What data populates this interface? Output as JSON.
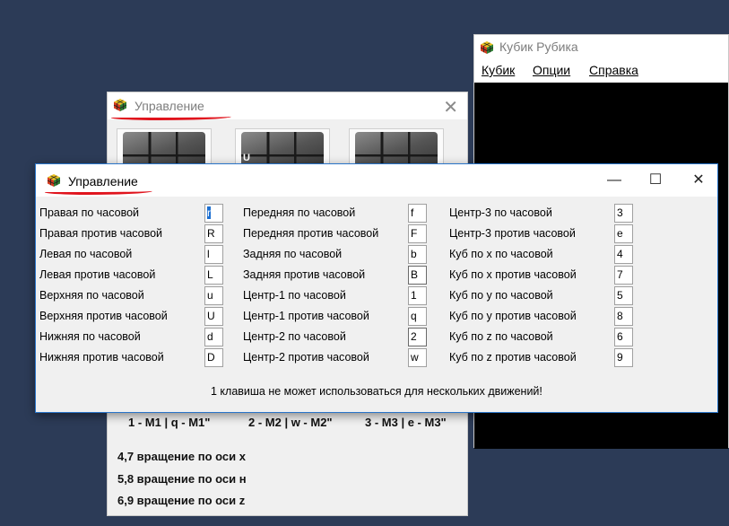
{
  "cube_window": {
    "title": "Кубик Рубика",
    "menu": [
      "Кубик",
      "Опции",
      "Справка"
    ]
  },
  "back_window": {
    "title": "Управление",
    "move_buttons": [
      {
        "letter": ""
      },
      {
        "letter": "U"
      },
      {
        "letter": ""
      }
    ],
    "hint_line": [
      "1 - M1 | q - M1\"",
      "2 - M2 | w - M2\"",
      "3 - M3 | e - M3\""
    ],
    "axis_lines": [
      "4,7 вращение по оси x",
      "5,8 вращение по оси н",
      "6,9 вращение по оси z"
    ]
  },
  "front_window": {
    "title": "Управление",
    "columns": [
      {
        "rows": [
          {
            "label": "Правая по часовой",
            "key": "r"
          },
          {
            "label": "Правая против часовой",
            "key": "R"
          },
          {
            "label": "Левая по часовой",
            "key": "l"
          },
          {
            "label": "Левая против часовой",
            "key": "L"
          },
          {
            "label": "Верхняя по часовой",
            "key": "u"
          },
          {
            "label": "Верхняя против часовой",
            "key": "U"
          },
          {
            "label": "Нижняя по часовой",
            "key": "d"
          },
          {
            "label": "Нижняя против часовой",
            "key": "D"
          }
        ]
      },
      {
        "rows": [
          {
            "label": "Передняя по часовой",
            "key": "f"
          },
          {
            "label": "Передняя против часовой",
            "key": "F"
          },
          {
            "label": "Задняя по часовой",
            "key": "b"
          },
          {
            "label": "Задняя против часовой",
            "key": "B"
          },
          {
            "label": "Центр-1 по часовой",
            "key": "1"
          },
          {
            "label": "Центр-1 против часовой",
            "key": "q"
          },
          {
            "label": "Центр-2 по часовой",
            "key": "2"
          },
          {
            "label": "Центр-2 против часовой",
            "key": "w"
          }
        ]
      },
      {
        "rows": [
          {
            "label": "Центр-3 по часовой",
            "key": "3"
          },
          {
            "label": "Центр-3 против часовой",
            "key": "e"
          },
          {
            "label": "Куб по x по часовой",
            "key": "4"
          },
          {
            "label": "Куб по x против часовой",
            "key": "7"
          },
          {
            "label": "Куб по y по часовой",
            "key": "5"
          },
          {
            "label": "Куб по y против часовой",
            "key": "8"
          },
          {
            "label": "Куб по z по часовой",
            "key": "6"
          },
          {
            "label": "Куб по z против часовой",
            "key": "9"
          }
        ]
      }
    ],
    "note": "1 клавиша не может использоваться для нескольких движений!"
  },
  "colors": {
    "desktop": "#2c3b57",
    "underline": "#e0141d",
    "selection": "#1c6fd1"
  }
}
